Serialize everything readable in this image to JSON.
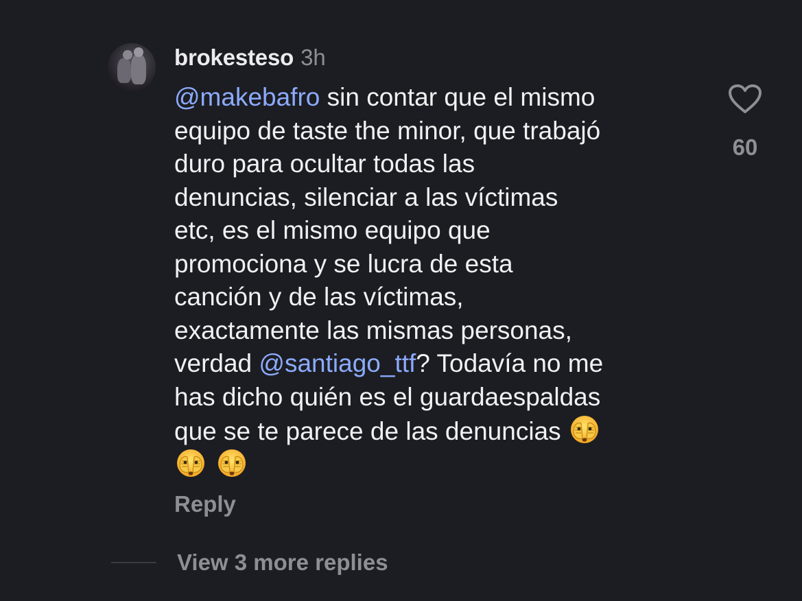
{
  "comment": {
    "username": "brokesteso",
    "time": "3h",
    "text_lines": [
      [
        {
          "t": "@makebafro",
          "mention": true
        },
        {
          "t": " sin contar que el mismo",
          "mention": false
        }
      ],
      [
        {
          "t": "equipo de taste the minor, que trabajó",
          "mention": false
        }
      ],
      [
        {
          "t": "duro para ocultar todas las",
          "mention": false
        }
      ],
      [
        {
          "t": "denuncias, silenciar a las víctimas",
          "mention": false
        }
      ],
      [
        {
          "t": "etc, es el mismo equipo que",
          "mention": false
        }
      ],
      [
        {
          "t": "promociona y se lucra de esta",
          "mention": false
        }
      ],
      [
        {
          "t": "canción y de las víctimas,",
          "mention": false
        }
      ],
      [
        {
          "t": "exactamente las mismas personas,",
          "mention": false
        }
      ],
      [
        {
          "t": "verdad ",
          "mention": false
        },
        {
          "t": "@santiago_ttf",
          "mention": true
        },
        {
          "t": "? Todavía no me",
          "mention": false
        }
      ],
      [
        {
          "t": "has dicho quién es el guardaespaldas",
          "mention": false
        }
      ],
      [
        {
          "t": "que se te parece de las denuncias ",
          "mention": false
        },
        {
          "emoji": "face-with-hands-over-eyes"
        }
      ],
      [
        {
          "emoji": "face-with-hands-over-eyes"
        },
        {
          "emoji": "face-with-hands-over-eyes"
        }
      ]
    ],
    "reply_label": "Reply",
    "view_replies_label": "View 3 more replies",
    "like_count": "60"
  },
  "icons": {
    "like": "heart-outline-icon",
    "avatar": "user-avatar"
  },
  "colors": {
    "background": "#1c1d22",
    "text": "#f1f1f3",
    "secondary": "#8e8f95",
    "mention": "#8cabff"
  }
}
